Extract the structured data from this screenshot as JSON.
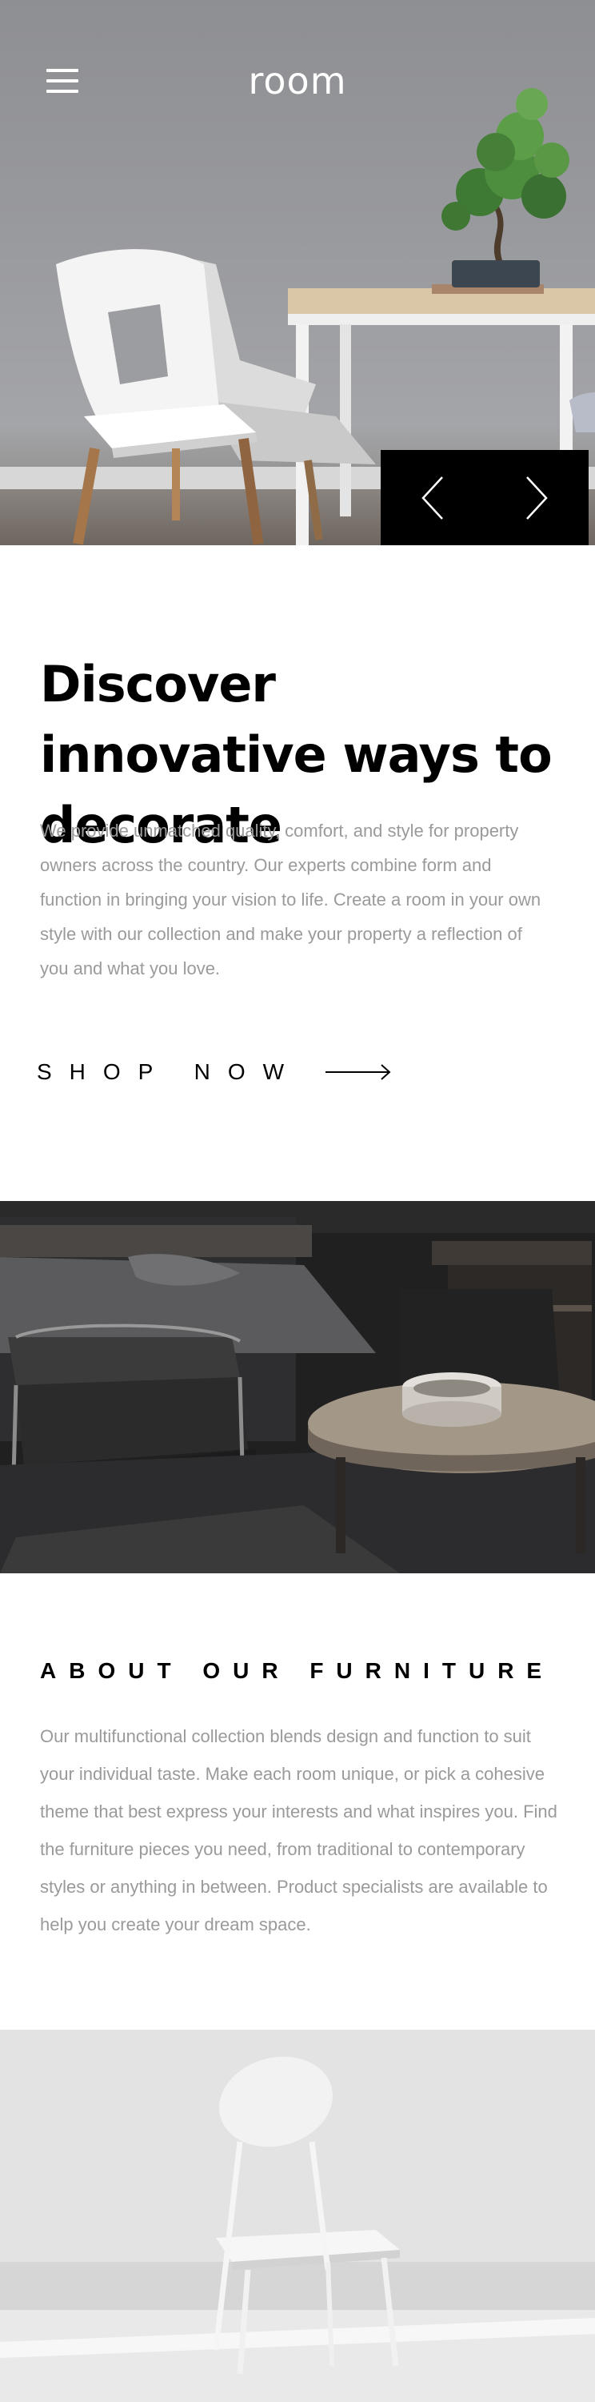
{
  "header": {
    "logo": "room",
    "menu_icon": "hamburger-menu-icon"
  },
  "hero": {
    "prev_icon": "chevron-left-icon",
    "next_icon": "chevron-right-icon"
  },
  "discover": {
    "title": "Discover innovative ways to decorate",
    "body": "We provide unmatched quality, comfort, and style for property owners across the country. Our experts combine form and function in bringing your vision to life. Create a room in your own style with our collection and make your property a reflection of you and what you love.",
    "cta_label": "SHOP NOW",
    "cta_icon": "arrow-right-icon"
  },
  "about": {
    "title": "ABOUT OUR FURNITURE",
    "body": "Our multifunctional collection blends design and function to suit your individual taste. Make each room unique, or pick a cohesive theme that best express your interests and what inspires you. Find the furniture pieces you need, from traditional to contemporary styles or anything in between. Product specialists are available to help you create your dream space."
  },
  "colors": {
    "text": "#000000",
    "muted_text": "#9a9a9a",
    "nav_background": "#000000"
  }
}
